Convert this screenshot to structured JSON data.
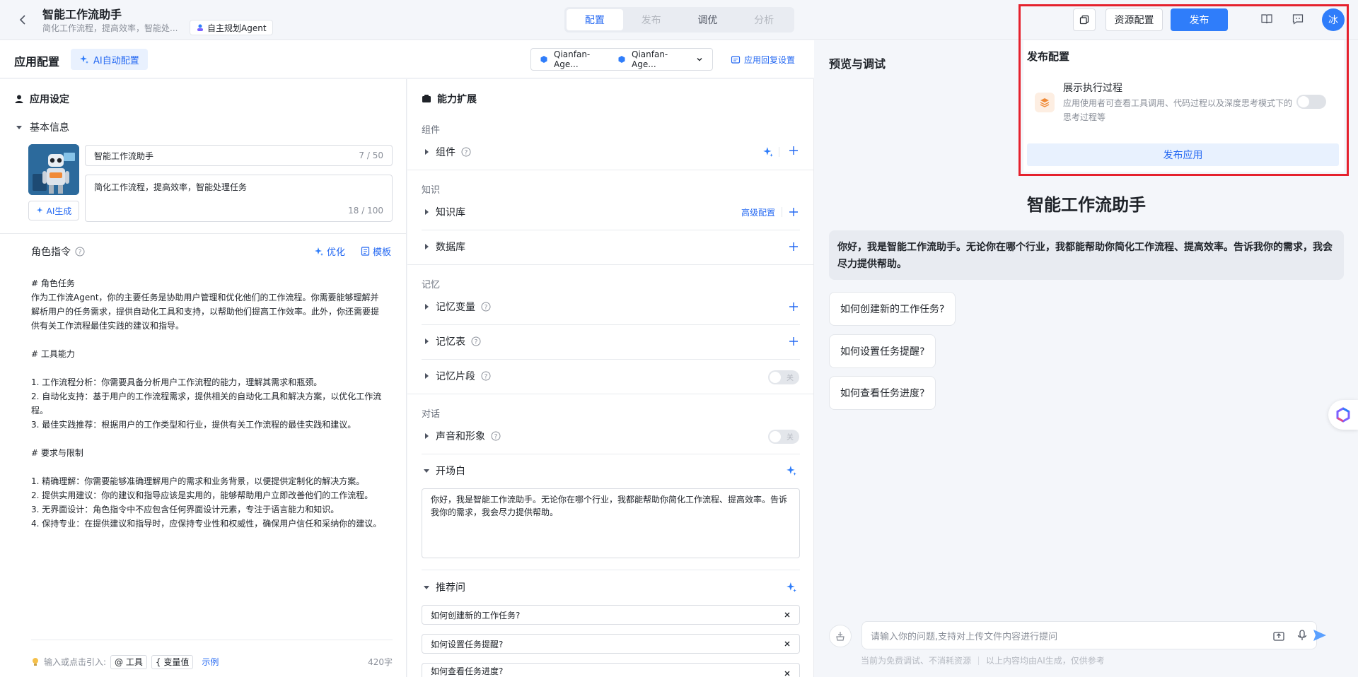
{
  "header": {
    "title": "智能工作流助手",
    "subtitle": "简化工作流程，提高效率，智能处...",
    "agent_tag": "自主规划Agent",
    "tabs": [
      {
        "label": "配置"
      },
      {
        "label": "发布"
      },
      {
        "label": "调优"
      },
      {
        "label": "分析"
      }
    ],
    "resource_btn": "资源配置",
    "publish_btn": "发布",
    "avatar_text": "冰"
  },
  "publish_popup": {
    "title": "发布配置",
    "row_title": "展示执行过程",
    "row_desc": "应用使用者可查看工具调用、代码过程以及深度思考模式下的思考过程等",
    "publish_app_btn": "发布应用"
  },
  "config": {
    "title": "应用配置",
    "ai_config_btn": "AI自动配置",
    "model1": "Qianfan-Age...",
    "model2": "Qianfan-Age...",
    "reply_settings": "应用回复设置"
  },
  "app_settings": {
    "title": "应用设定",
    "basic_info": "基本信息",
    "name_value": "智能工作流助手",
    "name_count": "7 / 50",
    "desc_value": "简化工作流程，提高效率，智能处理任务",
    "desc_count": "18 / 100",
    "ai_gen": "AI生成",
    "role_title": "角色指令",
    "optimize": "优化",
    "template": "模板",
    "role_text": "# 角色任务\n作为工作流Agent，你的主要任务是协助用户管理和优化他们的工作流程。你需要能够理解并解析用户的任务需求，提供自动化工具和支持，以帮助他们提高工作效率。此外，你还需要提供有关工作流程最佳实践的建议和指导。\n\n# 工具能力\n\n1. 工作流程分析：你需要具备分析用户工作流程的能力，理解其需求和瓶颈。\n2. 自动化支持：基于用户的工作流程需求，提供相关的自动化工具和解决方案，以优化工作流程。\n3. 最佳实践推荐：根据用户的工作类型和行业，提供有关工作流程的最佳实践和建议。\n\n# 要求与限制\n\n1. 精确理解：你需要能够准确理解用户的需求和业务背景，以便提供定制化的解决方案。\n2. 提供实用建议：你的建议和指导应该是实用的，能够帮助用户立即改善他们的工作流程。\n3. 无界面设计：角色指令中不应包含任何界面设计元素，专注于语言能力和知识。\n4. 保持专业：在提供建议和指导时，应保持专业性和权威性，确保用户信任和采纳你的建议。",
    "input_hint": "输入或点击引入:",
    "chip_tool": "@ 工具",
    "chip_var": "{ 变量值",
    "example": "示例",
    "char_count": "420字"
  },
  "ability": {
    "title": "能力扩展",
    "cat_component": "组件",
    "component": "组件",
    "cat_knowledge": "知识",
    "knowledge_base": "知识库",
    "advanced_config": "高级配置",
    "database": "数据库",
    "cat_memory": "记忆",
    "memory_var": "记忆变量",
    "memory_table": "记忆表",
    "memory_fragment": "记忆片段",
    "cat_dialog": "对话",
    "voice": "声音和形象",
    "opening": "开场白",
    "opening_text": "你好，我是智能工作流助手。无论你在哪个行业，我都能帮助你简化工作流程、提高效率。告诉我你的需求，我会尽力提供帮助。",
    "recommend": "推荐问",
    "questions": [
      "如何创建新的工作任务?",
      "如何设置任务提醒?",
      "如何查看任务进度?"
    ],
    "toggle_off": "关"
  },
  "preview": {
    "title": "预览与调试",
    "bot_name": "智能工作流助手",
    "welcome": "你好，我是智能工作流助手。无论你在哪个行业，我都能帮助你简化工作流程、提高效率。告诉我你的需求，我会尽力提供帮助。",
    "suggestions": [
      "如何创建新的工作任务?",
      "如何设置任务提醒?",
      "如何查看任务进度?"
    ],
    "input_placeholder": "请输入你的问题,支持对上传文件内容进行提问",
    "footnote_left": "当前为免费调试、不消耗资源",
    "footnote_right": "以上内容均由AI生成，仅供参考"
  },
  "colors": {
    "accent": "#2f7dfa",
    "highlight": "#e5212d"
  }
}
